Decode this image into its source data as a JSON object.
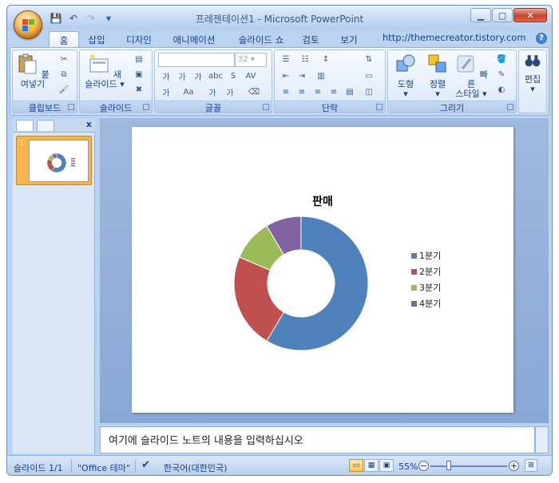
{
  "window": {
    "title": "프레젠테이션1 - Microsoft PowerPoint",
    "site": "http://themecreator.tistory.com"
  },
  "tabs": [
    {
      "label": "홈",
      "active": true
    },
    {
      "label": "삽입"
    },
    {
      "label": "디자인"
    },
    {
      "label": "애니메이션"
    },
    {
      "label": "슬라이드 쇼"
    },
    {
      "label": "검토"
    },
    {
      "label": "보기"
    }
  ],
  "ribbon": {
    "clipboard": {
      "label": "클립보드",
      "paste": "붙여넣기"
    },
    "slides": {
      "label": "슬라이드",
      "new_slide_line1": "새",
      "new_slide_line2": "슬라이드"
    },
    "font": {
      "label": "글꼴",
      "size": "32"
    },
    "paragraph": {
      "label": "단락"
    },
    "drawing": {
      "label": "그리기",
      "shapes": "도형",
      "arrange": "정렬",
      "quick_line1": "빠른",
      "quick_line2": "스타일"
    },
    "editing": {
      "label": "편집"
    }
  },
  "slide_panel": {
    "slide_number": "1"
  },
  "chart_data": {
    "type": "pie",
    "title": "판매",
    "donut": true,
    "categories": [
      "1분기",
      "2분기",
      "3분기",
      "4분기"
    ],
    "values": [
      8.2,
      3.2,
      1.4,
      1.2
    ],
    "colors": [
      "#4f81bd",
      "#c0504d",
      "#9bbb59",
      "#8064a2"
    ],
    "legend": "right"
  },
  "notes": {
    "placeholder": "여기에 슬라이드 노트의 내용을 입력하십시오"
  },
  "status": {
    "slide": "슬라이드 1/1",
    "theme": "\"Office 테마\"",
    "language": "한국어(대한민국)",
    "zoom": "55%"
  }
}
